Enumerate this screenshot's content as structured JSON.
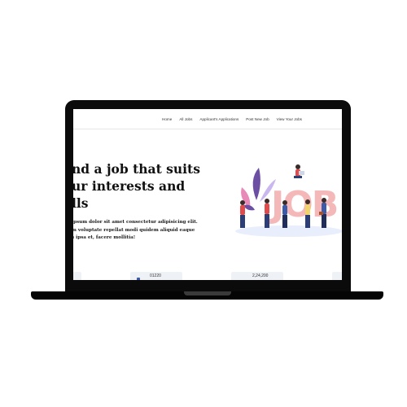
{
  "nav": {
    "links": [
      "Home",
      "All Jobs",
      "Applicant's Applications",
      "Post New Job",
      "View Your Jobs"
    ]
  },
  "hero": {
    "title_lines": [
      "nd a job that suits",
      "ur interests and",
      "lls"
    ],
    "description_lines": [
      "ipsum dolor sit amet consectetur adipisicing elit.",
      "m voluptate repellat modi quidem aliquid eaque",
      "s ipsa et, facere mollitia!"
    ]
  },
  "illustration": {
    "letters": "JOB"
  },
  "stats": [
    {
      "value": "01220"
    },
    {
      "value": "2,24,200"
    }
  ],
  "colors": {
    "frame": "#0b0b0b",
    "job_letters": "#f4b8b8",
    "accent_blue": "#3c5aa8",
    "accent_red": "#e14b4b"
  }
}
